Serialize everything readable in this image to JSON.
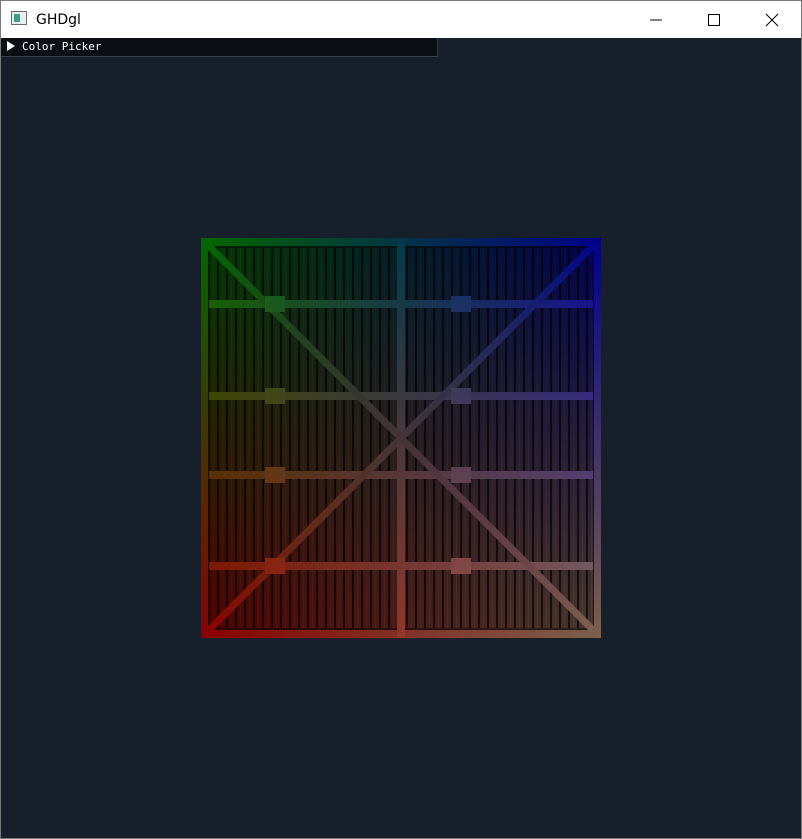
{
  "window": {
    "title": "GHDgl",
    "icon": "app-window-icon",
    "controls": {
      "minimize_icon": "minimize-icon",
      "maximize_icon": "maximize-icon",
      "close_icon": "close-icon"
    }
  },
  "color_picker": {
    "label": "Color Picker",
    "collapsed": true,
    "arrow_icon": "triangle-right-icon"
  },
  "viewport": {
    "background_color": "#17202a",
    "quad": {
      "texture": "wooden crate face",
      "corner_colors": {
        "top_left": "#00c000",
        "top_right": "#0000ff",
        "bottom_left": "#ff0000",
        "bottom_right": "#e6b48c"
      }
    }
  }
}
